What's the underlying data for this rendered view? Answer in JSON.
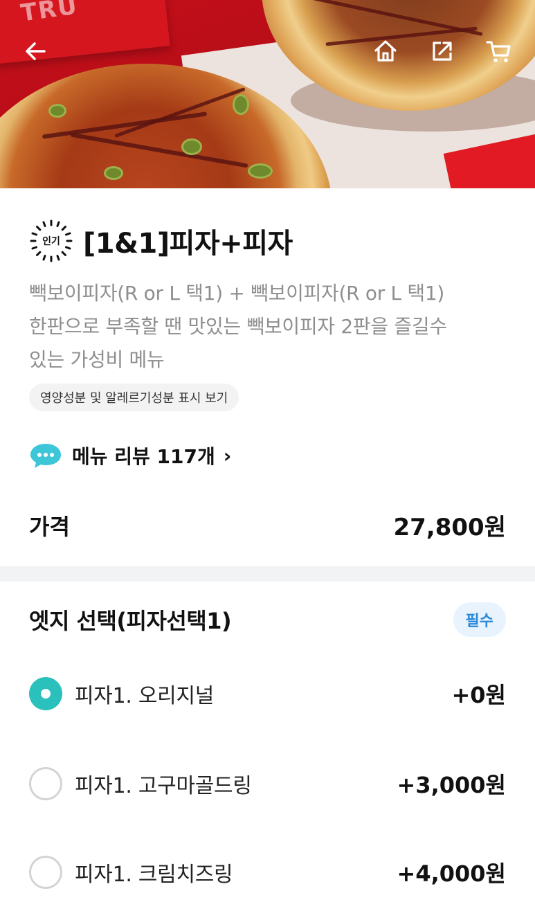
{
  "hero": {
    "box_logo": "TRU"
  },
  "header": {
    "icons": [
      "back-arrow-icon",
      "home-icon",
      "share-icon",
      "cart-icon"
    ]
  },
  "product": {
    "badge": "인기",
    "title": "[1&1]피자+피자",
    "description_lines": [
      "빽보이피자(R or L 택1) + 빽보이피자(R or L 택1)",
      "한판으로 부족할 땐 맛있는 빽보이피자 2판을 즐길수",
      "있는 가성비 메뉴"
    ],
    "nutrition_button": "영양성분 및 알레르기성분 표시 보기",
    "review_link": "메뉴 리뷰 117개",
    "price_label": "가격",
    "price_value": "27,800원"
  },
  "options": {
    "title": "엣지 선택(피자선택1)",
    "required_badge": "필수",
    "items": [
      {
        "label": "피자1. 오리지널",
        "price": "+0원",
        "selected": true
      },
      {
        "label": "피자1. 고구마골드링",
        "price": "+3,000원",
        "selected": false
      },
      {
        "label": "피자1. 크림치즈링",
        "price": "+4,000원",
        "selected": false
      }
    ]
  },
  "colors": {
    "accent": "#2ac1bc",
    "required_text": "#2a88d8",
    "required_bg": "#e8f3fd"
  }
}
